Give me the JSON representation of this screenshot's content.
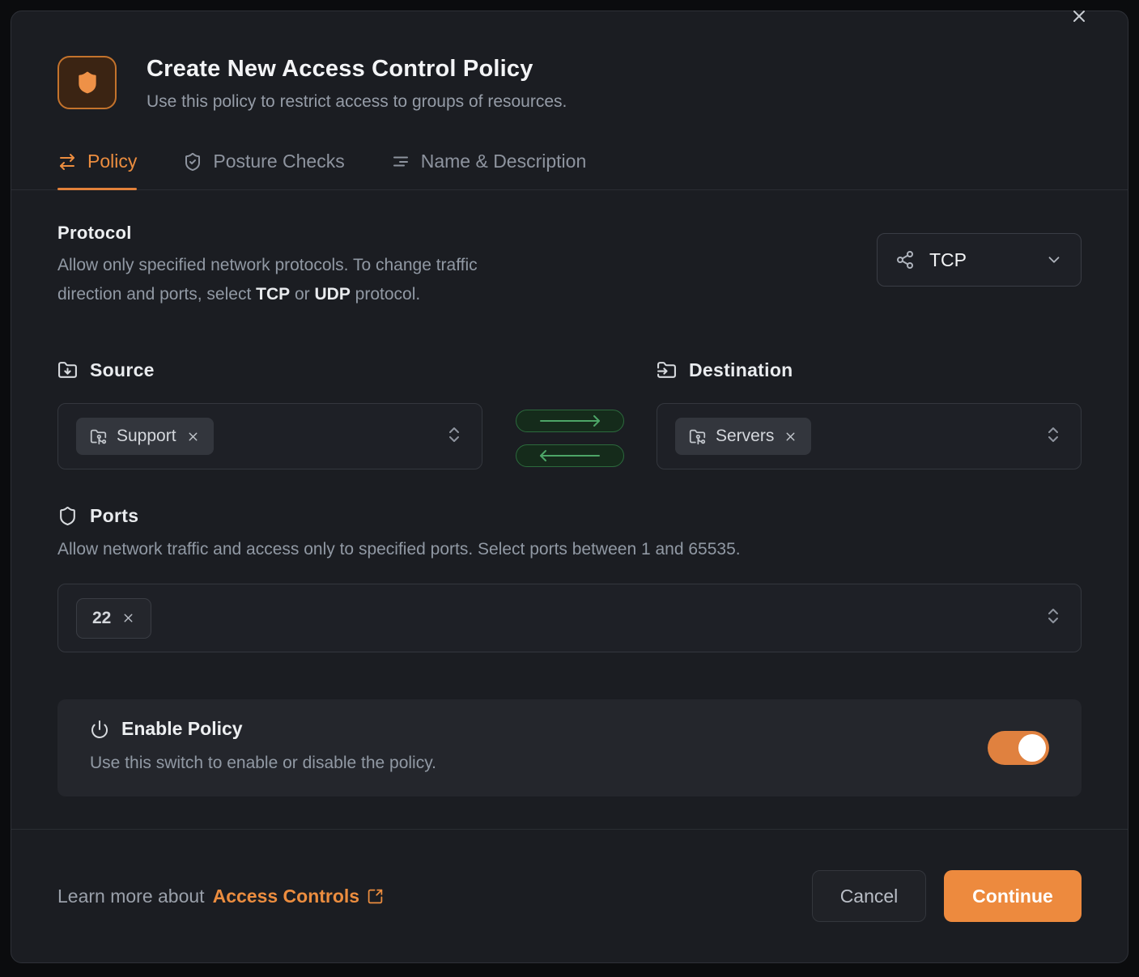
{
  "modal": {
    "title": "Create New Access Control Policy",
    "subtitle": "Use this policy to restrict access to groups of resources."
  },
  "tabs": {
    "policy": "Policy",
    "posture_checks": "Posture Checks",
    "name_description": "Name & Description",
    "active_tab": "Policy"
  },
  "protocol": {
    "heading": "Protocol",
    "desc_line1": "Allow only specified network protocols. To change traffic",
    "desc_line2_pre": "direction and ports, select ",
    "tcp_bold": "TCP",
    "desc_line2_mid": " or ",
    "udp_bold": "UDP",
    "desc_line2_post": " protocol.",
    "selected_value": "TCP"
  },
  "source": {
    "heading": "Source",
    "tag_label": "Support"
  },
  "destination": {
    "heading": "Destination",
    "tag_label": "Servers"
  },
  "traffic_direction": {
    "forward_enabled": true,
    "return_enabled": true
  },
  "ports": {
    "heading": "Ports",
    "description": "Allow network traffic and access only to specified ports. Select ports between 1 and 65535.",
    "tag_label": "22"
  },
  "enable_policy": {
    "heading": "Enable Policy",
    "description": "Use this switch to enable or disable the policy.",
    "enabled": true
  },
  "footer": {
    "learn_more_text": "Learn more about",
    "learn_more_link": "Access Controls",
    "cancel_label": "Cancel",
    "continue_label": "Continue"
  },
  "icons": {
    "header": "shield-icon",
    "tab_policy": "arrows-swap-icon",
    "tab_posture": "shield-check-icon",
    "tab_name": "text-lines-icon",
    "protocol_select": "share-network-icon",
    "source": "folder-down-icon",
    "destination": "folder-input-icon",
    "tag": "folder-git-icon",
    "ports": "shield-outline-icon",
    "enable": "power-icon",
    "link": "external-link-icon"
  },
  "colors": {
    "accent_orange": "#ed8a3e",
    "tab_active_orange": "#ec8d3f",
    "green_arrow": "#4da567",
    "modal_bg": "#1b1d22",
    "card_bg": "#24262c",
    "toggle_on": "#e0813f"
  }
}
